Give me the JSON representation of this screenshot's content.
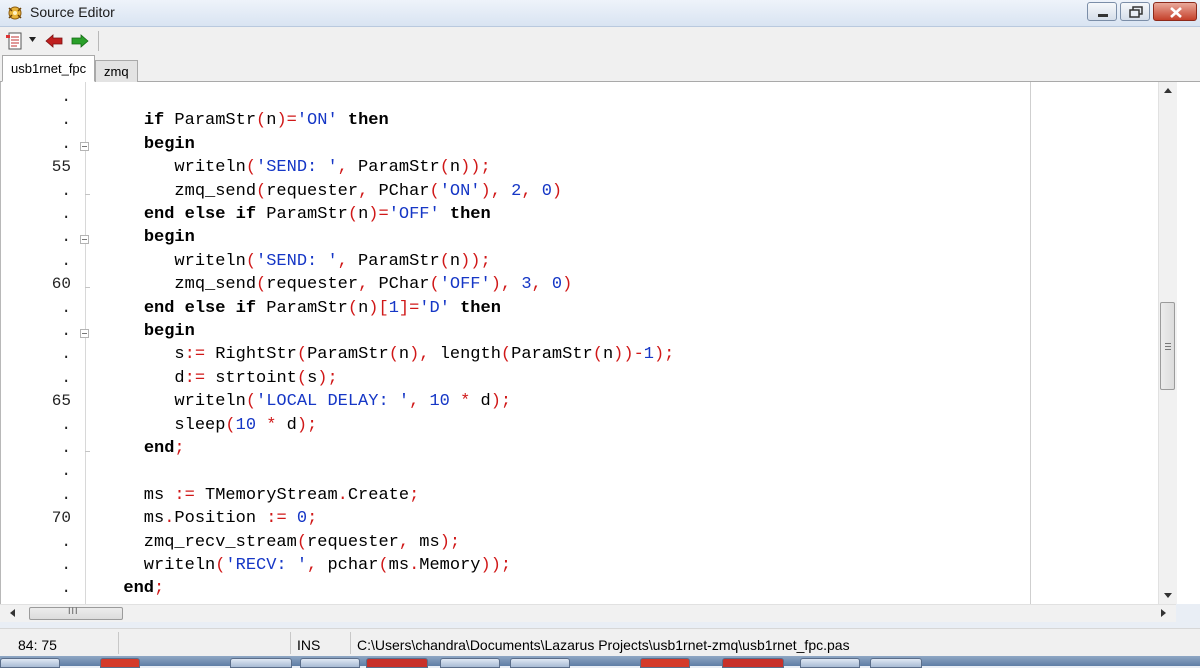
{
  "window": {
    "title": "Source Editor",
    "buttons": {
      "minimize": "minimize",
      "maximize": "maximize",
      "close": "close"
    }
  },
  "toolbar": {
    "items": [
      "document-list-icon",
      "dropdown-arrow-icon",
      "back-arrow-icon",
      "forward-arrow-icon"
    ]
  },
  "tabs": [
    {
      "label": "usb1rnet_fpc",
      "active": true
    },
    {
      "label": "zmq",
      "active": false
    }
  ],
  "editor": {
    "gutter": [
      ".",
      ".",
      ".",
      "55",
      ".",
      ".",
      ".",
      ".",
      "60",
      ".",
      ".",
      ".",
      ".",
      "65",
      ".",
      ".",
      ".",
      ".",
      "70",
      ".",
      ".",
      "."
    ],
    "lines": [
      [],
      [
        [
          "    ",
          ""
        ],
        [
          "if",
          "kw"
        ],
        [
          " ParamStr",
          ""
        ],
        [
          "(",
          "sym"
        ],
        [
          "n",
          ""
        ],
        [
          ")",
          "sym"
        ],
        [
          "=",
          "sym"
        ],
        [
          "'ON'",
          "str"
        ],
        [
          " ",
          ""
        ],
        [
          "then",
          "kw"
        ]
      ],
      [
        [
          "    ",
          ""
        ],
        [
          "begin",
          "kw"
        ]
      ],
      [
        [
          "       writeln",
          ""
        ],
        [
          "(",
          "sym"
        ],
        [
          "'SEND: '",
          "str"
        ],
        [
          ",",
          "sym"
        ],
        [
          " ParamStr",
          ""
        ],
        [
          "(",
          "sym"
        ],
        [
          "n",
          ""
        ],
        [
          "))",
          "sym"
        ],
        [
          ";",
          "sym"
        ]
      ],
      [
        [
          "       zmq_send",
          ""
        ],
        [
          "(",
          "sym"
        ],
        [
          "requester",
          ""
        ],
        [
          ",",
          "sym"
        ],
        [
          " PChar",
          ""
        ],
        [
          "(",
          "sym"
        ],
        [
          "'ON'",
          "str"
        ],
        [
          ")",
          "sym"
        ],
        [
          ",",
          "sym"
        ],
        [
          " ",
          ""
        ],
        [
          "2",
          "num"
        ],
        [
          ",",
          "sym"
        ],
        [
          " ",
          ""
        ],
        [
          "0",
          "num"
        ],
        [
          ")",
          "sym"
        ]
      ],
      [
        [
          "    ",
          ""
        ],
        [
          "end",
          "kw"
        ],
        [
          " ",
          ""
        ],
        [
          "else",
          "kw"
        ],
        [
          " ",
          ""
        ],
        [
          "if",
          "kw"
        ],
        [
          " ParamStr",
          ""
        ],
        [
          "(",
          "sym"
        ],
        [
          "n",
          ""
        ],
        [
          ")",
          "sym"
        ],
        [
          "=",
          "sym"
        ],
        [
          "'OFF'",
          "str"
        ],
        [
          " ",
          ""
        ],
        [
          "then",
          "kw"
        ]
      ],
      [
        [
          "    ",
          ""
        ],
        [
          "begin",
          "kw"
        ]
      ],
      [
        [
          "       writeln",
          ""
        ],
        [
          "(",
          "sym"
        ],
        [
          "'SEND: '",
          "str"
        ],
        [
          ",",
          "sym"
        ],
        [
          " ParamStr",
          ""
        ],
        [
          "(",
          "sym"
        ],
        [
          "n",
          ""
        ],
        [
          "))",
          "sym"
        ],
        [
          ";",
          "sym"
        ]
      ],
      [
        [
          "       zmq_send",
          ""
        ],
        [
          "(",
          "sym"
        ],
        [
          "requester",
          ""
        ],
        [
          ",",
          "sym"
        ],
        [
          " PChar",
          ""
        ],
        [
          "(",
          "sym"
        ],
        [
          "'OFF'",
          "str"
        ],
        [
          ")",
          "sym"
        ],
        [
          ",",
          "sym"
        ],
        [
          " ",
          ""
        ],
        [
          "3",
          "num"
        ],
        [
          ",",
          "sym"
        ],
        [
          " ",
          ""
        ],
        [
          "0",
          "num"
        ],
        [
          ")",
          "sym"
        ]
      ],
      [
        [
          "    ",
          ""
        ],
        [
          "end",
          "kw"
        ],
        [
          " ",
          ""
        ],
        [
          "else",
          "kw"
        ],
        [
          " ",
          ""
        ],
        [
          "if",
          "kw"
        ],
        [
          " ParamStr",
          ""
        ],
        [
          "(",
          "sym"
        ],
        [
          "n",
          ""
        ],
        [
          ")",
          "sym"
        ],
        [
          "[",
          "sym"
        ],
        [
          "1",
          "num"
        ],
        [
          "]",
          "sym"
        ],
        [
          "=",
          "sym"
        ],
        [
          "'D'",
          "str"
        ],
        [
          " ",
          ""
        ],
        [
          "then",
          "kw"
        ]
      ],
      [
        [
          "    ",
          ""
        ],
        [
          "begin",
          "kw"
        ]
      ],
      [
        [
          "       s",
          ""
        ],
        [
          ":=",
          "sym"
        ],
        [
          " RightStr",
          ""
        ],
        [
          "(",
          "sym"
        ],
        [
          "ParamStr",
          ""
        ],
        [
          "(",
          "sym"
        ],
        [
          "n",
          ""
        ],
        [
          ")",
          "sym"
        ],
        [
          ",",
          "sym"
        ],
        [
          " length",
          ""
        ],
        [
          "(",
          "sym"
        ],
        [
          "ParamStr",
          ""
        ],
        [
          "(",
          "sym"
        ],
        [
          "n",
          ""
        ],
        [
          "))",
          "sym"
        ],
        [
          "-",
          "sym"
        ],
        [
          "1",
          "num"
        ],
        [
          ")",
          "sym"
        ],
        [
          ";",
          "sym"
        ]
      ],
      [
        [
          "       d",
          ""
        ],
        [
          ":=",
          "sym"
        ],
        [
          " strtoint",
          ""
        ],
        [
          "(",
          "sym"
        ],
        [
          "s",
          ""
        ],
        [
          ")",
          "sym"
        ],
        [
          ";",
          "sym"
        ]
      ],
      [
        [
          "       writeln",
          ""
        ],
        [
          "(",
          "sym"
        ],
        [
          "'LOCAL DELAY: '",
          "str"
        ],
        [
          ",",
          "sym"
        ],
        [
          " ",
          ""
        ],
        [
          "10",
          "num"
        ],
        [
          " ",
          ""
        ],
        [
          "*",
          "sym"
        ],
        [
          " d",
          ""
        ],
        [
          ")",
          "sym"
        ],
        [
          ";",
          "sym"
        ]
      ],
      [
        [
          "       sleep",
          ""
        ],
        [
          "(",
          "sym"
        ],
        [
          "10",
          "num"
        ],
        [
          " ",
          ""
        ],
        [
          "*",
          "sym"
        ],
        [
          " d",
          ""
        ],
        [
          ")",
          "sym"
        ],
        [
          ";",
          "sym"
        ]
      ],
      [
        [
          "    ",
          ""
        ],
        [
          "end",
          "kw"
        ],
        [
          ";",
          "sym"
        ]
      ],
      [],
      [
        [
          "    ms ",
          ""
        ],
        [
          ":=",
          "sym"
        ],
        [
          " TMemoryStream",
          ""
        ],
        [
          ".",
          "sym"
        ],
        [
          "Create",
          ""
        ],
        [
          ";",
          "sym"
        ]
      ],
      [
        [
          "    ms",
          ""
        ],
        [
          ".",
          "sym"
        ],
        [
          "Position ",
          ""
        ],
        [
          ":=",
          "sym"
        ],
        [
          " ",
          ""
        ],
        [
          "0",
          "num"
        ],
        [
          ";",
          "sym"
        ]
      ],
      [
        [
          "    zmq_recv_stream",
          ""
        ],
        [
          "(",
          "sym"
        ],
        [
          "requester",
          ""
        ],
        [
          ",",
          "sym"
        ],
        [
          " ms",
          ""
        ],
        [
          ")",
          "sym"
        ],
        [
          ";",
          "sym"
        ]
      ],
      [
        [
          "    writeln",
          ""
        ],
        [
          "(",
          "sym"
        ],
        [
          "'RECV: '",
          "str"
        ],
        [
          ",",
          "sym"
        ],
        [
          " pchar",
          ""
        ],
        [
          "(",
          "sym"
        ],
        [
          "ms",
          ""
        ],
        [
          ".",
          "sym"
        ],
        [
          "Memory",
          ""
        ],
        [
          "))",
          "sym"
        ],
        [
          ";",
          "sym"
        ]
      ],
      [
        [
          "  ",
          ""
        ],
        [
          "end",
          "kw"
        ],
        [
          ";",
          "sym"
        ]
      ]
    ]
  },
  "statusbar": {
    "position": "84: 75",
    "mode": "INS",
    "path": "C:\\Users\\chandra\\Documents\\Lazarus Projects\\usb1rnet-zmq\\usb1rnet_fpc.pas"
  },
  "scrollbar": {
    "horizontal_grip": "III"
  },
  "colors": {
    "keyword": "#000000",
    "symbol": "#d01818",
    "string": "#1637c6",
    "number": "#1637c6"
  }
}
